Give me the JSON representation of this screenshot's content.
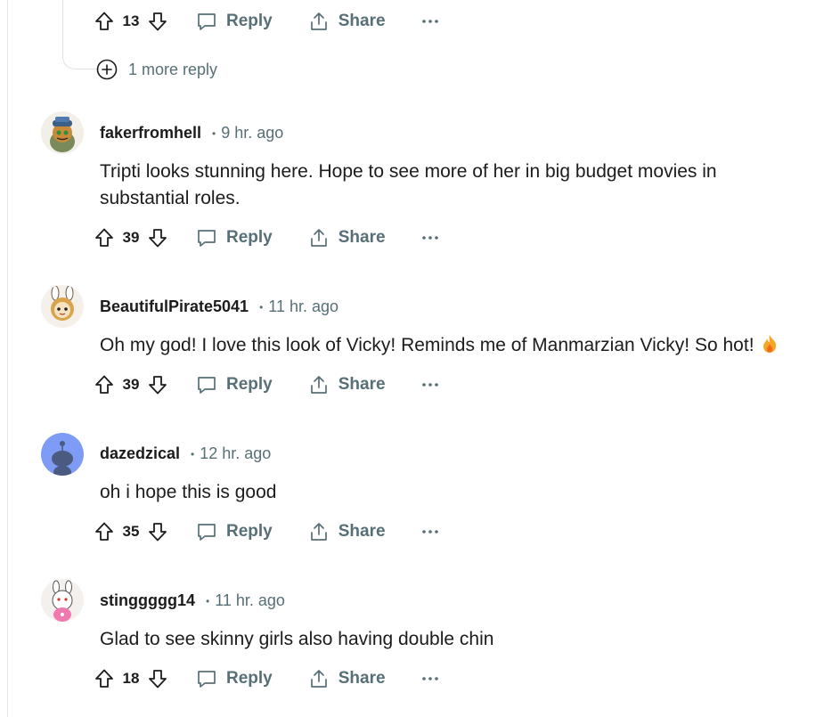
{
  "top_reply": {
    "score": "13",
    "reply_label": "Reply",
    "share_label": "Share",
    "more_replies": "1 more reply"
  },
  "comments": [
    {
      "username": "fakerfromhell",
      "time": "9 hr. ago",
      "text": "Tripti looks stunning here. Hope to see more of her in big budget movies in substantial roles.",
      "score": "39",
      "reply_label": "Reply",
      "share_label": "Share",
      "avatar_icon": "snoo-avatar-captain"
    },
    {
      "username": "BeautifulPirate5041",
      "time": "11 hr. ago",
      "text": "Oh my god! I love this look of Vicky! Reminds me of Manmarzian Vicky! So hot!",
      "emoji": "fire-emoji",
      "score": "39",
      "reply_label": "Reply",
      "share_label": "Share",
      "avatar_icon": "snoo-avatar-bunny"
    },
    {
      "username": "dazedzical",
      "time": "12 hr. ago",
      "text": "oh i hope this is good",
      "score": "35",
      "reply_label": "Reply",
      "share_label": "Share",
      "avatar_icon": "default-snoo-avatar"
    },
    {
      "username": "stinggggg14",
      "time": "11 hr. ago",
      "text": "Glad to see skinny girls also having double chin",
      "score": "18",
      "reply_label": "Reply",
      "share_label": "Share",
      "avatar_icon": "snoo-avatar-bunny-pink"
    }
  ],
  "colors": {
    "muted": "#576f76",
    "text": "#1c1c1c",
    "default_avatar_bg": "#7e9cf5"
  }
}
